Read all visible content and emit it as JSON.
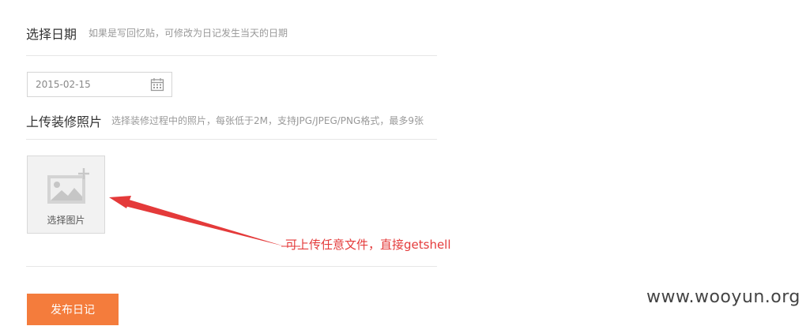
{
  "date_section": {
    "title": "选择日期",
    "hint": "如果是写回忆贴，可修改为日记发生当天的日期",
    "date_value": "2015-02-15",
    "icon": "calendar-icon"
  },
  "photo_section": {
    "title": "上传装修照片",
    "hint": "选择装修过程中的照片，每张低于2M，支持JPG/JPEG/PNG格式，最多9张",
    "upload_label": "选择图片",
    "icon": "add-image-icon"
  },
  "annotation": {
    "text": "可上传任意文件，直接getshell",
    "color": "#e43a3a"
  },
  "actions": {
    "publish_label": "发布日记",
    "accent": "#f47c3c"
  },
  "watermark": {
    "text": "www.wooyun.org"
  }
}
